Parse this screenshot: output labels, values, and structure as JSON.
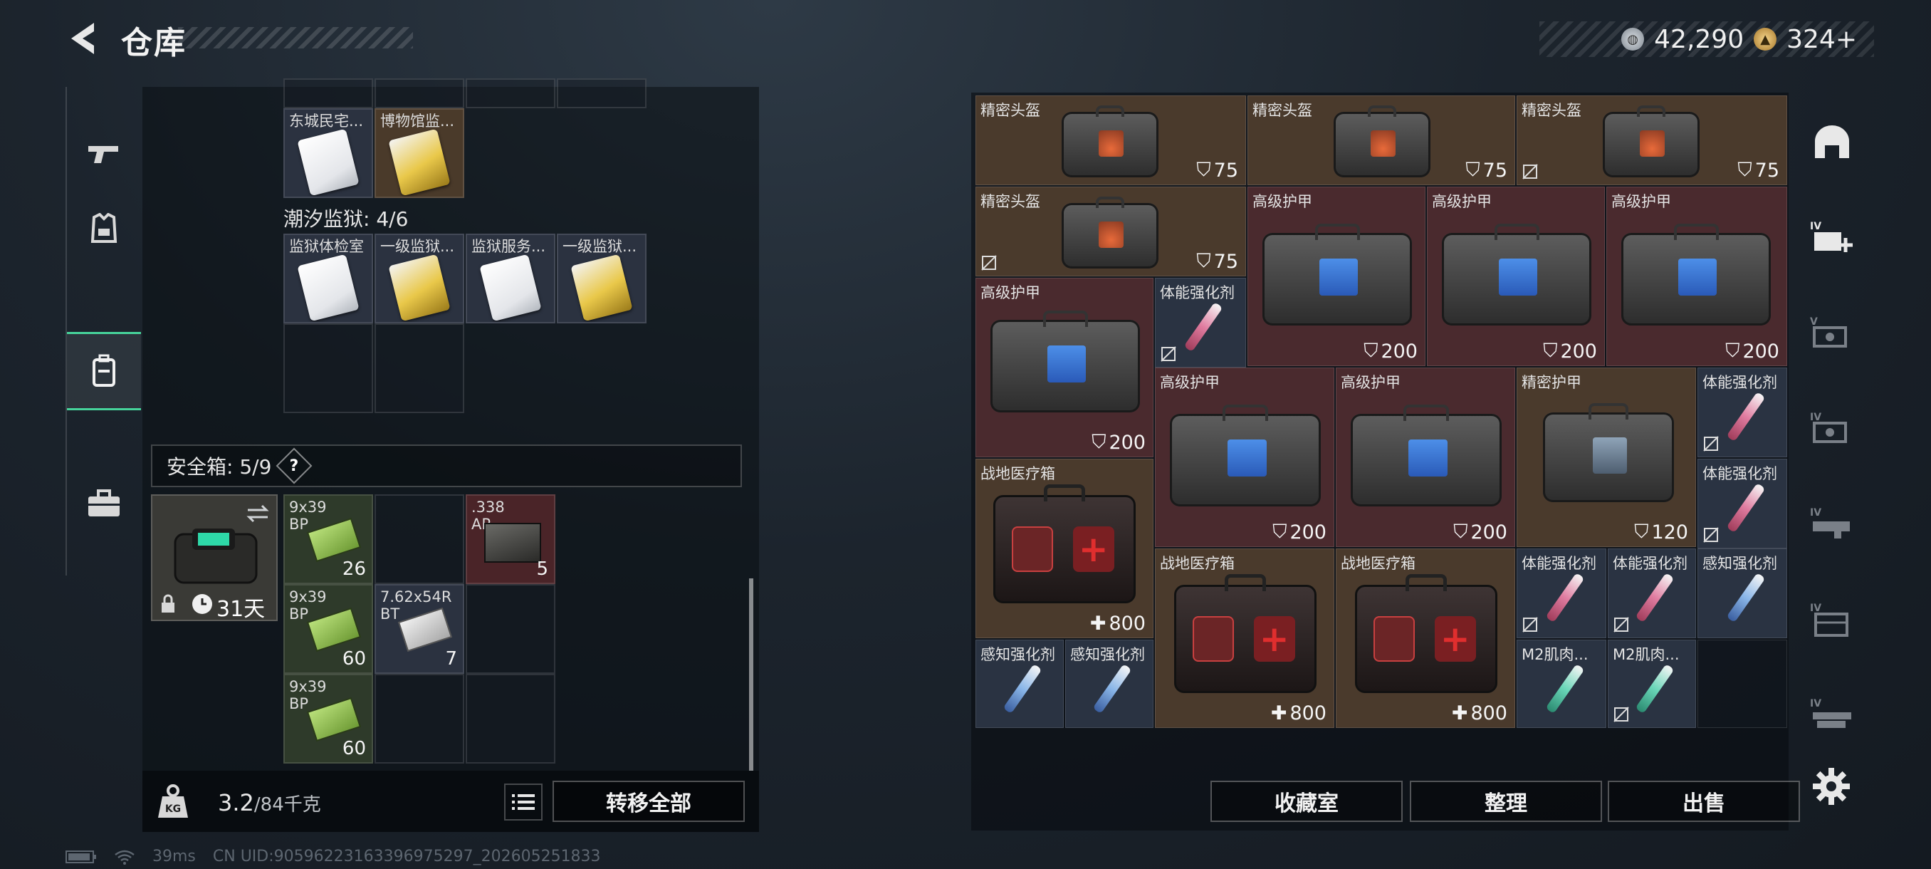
{
  "header": {
    "title": "仓库",
    "silver_amount": "42,290",
    "gold_amount": "324+"
  },
  "sidebar": {
    "tabs": [
      {
        "name": "weapons"
      },
      {
        "name": "gear"
      },
      {
        "name": "backpack",
        "active": true
      },
      {
        "name": "briefcase"
      }
    ]
  },
  "left": {
    "row0_labels": [
      "东城民宅...",
      "博物馆监..."
    ],
    "prison_section": "潮汐监狱: 4/6",
    "prison_labels": [
      "监狱体检室",
      "一级监狱...",
      "监狱服务...",
      "一级监狱..."
    ],
    "safe_title": "安全箱: 5/9",
    "safe_help": "?",
    "safe_timer": "31天",
    "safe_items": [
      {
        "name": "9x39 BP",
        "qty": "26"
      },
      {
        "name": ".338 AP",
        "qty": "5"
      },
      {
        "name": "9x39 BP",
        "qty": "60"
      },
      {
        "name": "7.62x54R BT",
        "qty": "7"
      },
      {
        "name": "9x39 BP",
        "qty": "60"
      }
    ],
    "weight": "3.2",
    "weight_cap": "/84千克",
    "transfer_all": "转移全部"
  },
  "right": {
    "items": [
      {
        "name": "精密头盔",
        "val": "75"
      },
      {
        "name": "精密头盔",
        "val": "75"
      },
      {
        "name": "精密头盔",
        "val": "75"
      },
      {
        "name": "精密头盔",
        "val": "75"
      },
      {
        "name": "高级护甲",
        "val": "200"
      },
      {
        "name": "高级护甲",
        "val": "200"
      },
      {
        "name": "高级护甲",
        "val": "200"
      },
      {
        "name": "高级护甲",
        "val": "200"
      },
      {
        "name": "体能强化剂",
        "val": ""
      },
      {
        "name": "高级护甲",
        "val": "200"
      },
      {
        "name": "高级护甲",
        "val": "200"
      },
      {
        "name": "精密护甲",
        "val": "120"
      },
      {
        "name": "体能强化剂",
        "val": ""
      },
      {
        "name": "体能强化剂",
        "val": ""
      },
      {
        "name": "战地医疗箱",
        "val": "800"
      },
      {
        "name": "战地医疗箱",
        "val": "800"
      },
      {
        "name": "战地医疗箱",
        "val": "800"
      },
      {
        "name": "体能强化剂",
        "val": ""
      },
      {
        "name": "体能强化剂",
        "val": ""
      },
      {
        "name": "感知强化剂",
        "val": ""
      },
      {
        "name": "感知强化剂",
        "val": ""
      },
      {
        "name": "感知强化剂",
        "val": ""
      },
      {
        "name": "M2肌肉...",
        "val": ""
      },
      {
        "name": "M2肌肉...",
        "val": ""
      }
    ],
    "buttons": {
      "collection": "收藏室",
      "sort": "整理",
      "sell": "出售"
    }
  },
  "status": {
    "ping": "39ms",
    "uid": "CN UID:905962231633969752​97_202605251833"
  },
  "colors": {
    "accent_green": "#46d39a",
    "tan_rarity": "#4a3a2c",
    "maroon_rarity": "#4a2a2e"
  }
}
